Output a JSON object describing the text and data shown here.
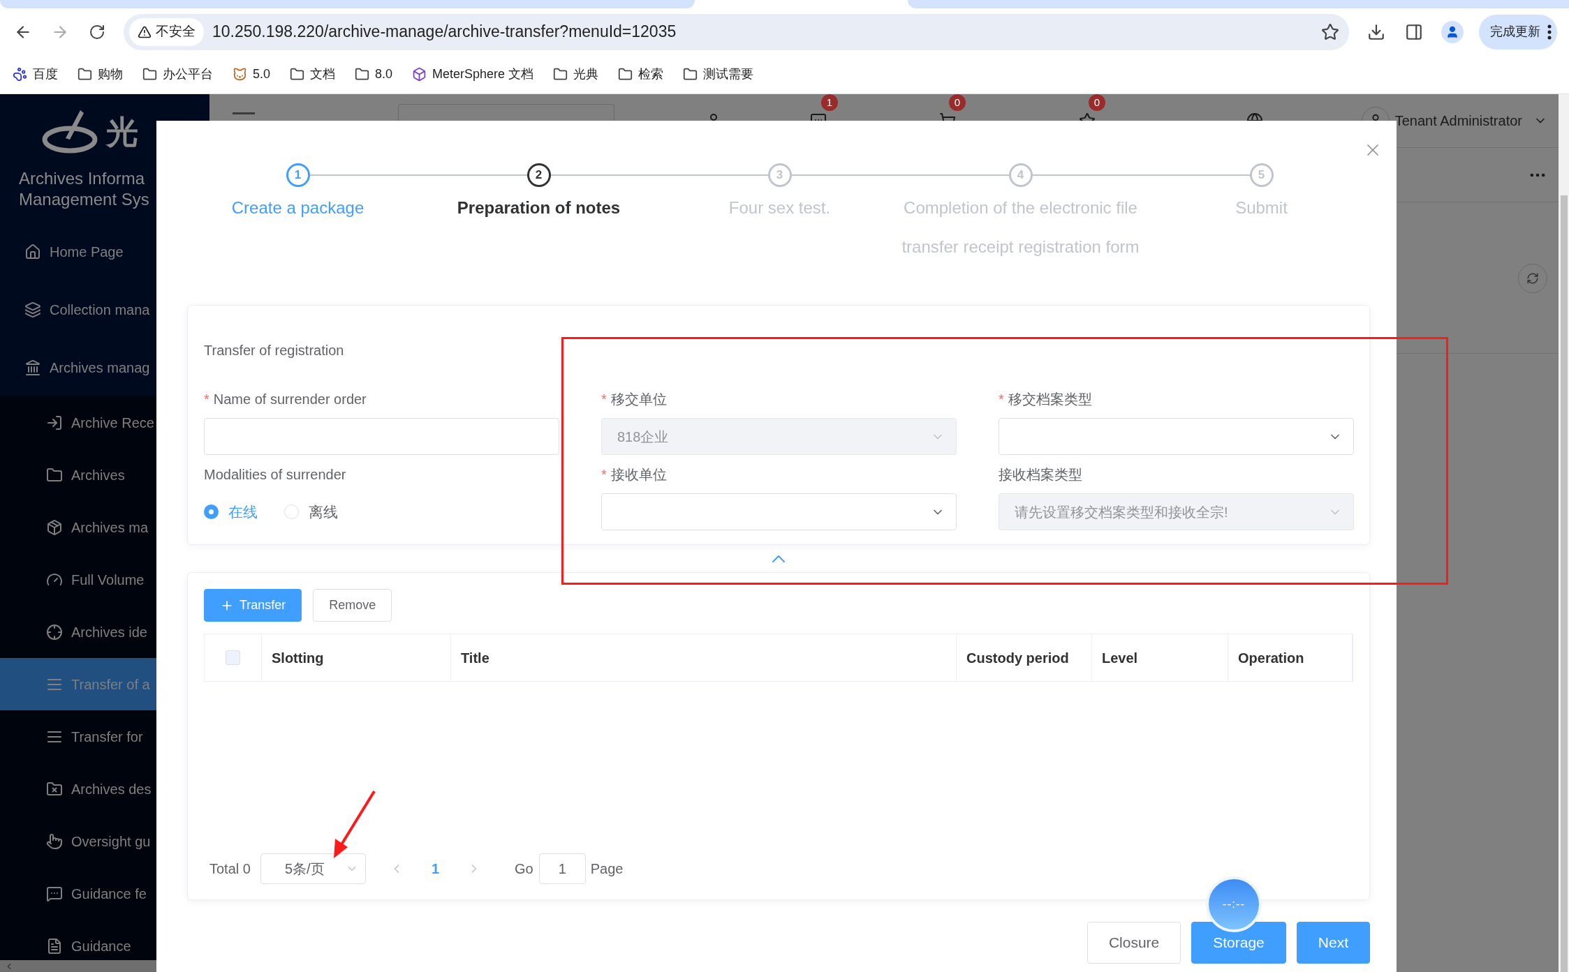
{
  "browser": {
    "insecure_label": "不安全",
    "url": "10.250.198.220/archive-manage/archive-transfer?menuId=12035",
    "update_button": "完成更新",
    "bookmarks": [
      {
        "label": "百度",
        "kind": "paw"
      },
      {
        "label": "购物",
        "kind": "folder"
      },
      {
        "label": "办公平台",
        "kind": "folder"
      },
      {
        "label": "5.0",
        "kind": "cat"
      },
      {
        "label": "文档",
        "kind": "folder"
      },
      {
        "label": "8.0",
        "kind": "folder"
      },
      {
        "label": "MeterSphere 文档",
        "kind": "cube"
      },
      {
        "label": "光典",
        "kind": "folder"
      },
      {
        "label": "检索",
        "kind": "folder"
      },
      {
        "label": "测试需要",
        "kind": "folder"
      }
    ]
  },
  "sidebar": {
    "logo_text": "光",
    "title_lines": [
      "Archives Informa",
      "Management Sys"
    ],
    "items": [
      {
        "label": "Home Page",
        "selected": false
      },
      {
        "label": "Collection mana",
        "selected": false
      },
      {
        "label": "Archives manag",
        "selected": false
      },
      {
        "label": "Archive Rece",
        "selected": false
      },
      {
        "label": "Archives",
        "selected": false
      },
      {
        "label": "Archives ma",
        "selected": false
      },
      {
        "label": "Full Volume",
        "selected": false
      },
      {
        "label": "Archives ide",
        "selected": false
      },
      {
        "label": "Transfer of a",
        "selected": true
      },
      {
        "label": "Transfer for",
        "selected": false
      },
      {
        "label": "Archives des",
        "selected": false
      },
      {
        "label": "Oversight gu",
        "selected": false
      },
      {
        "label": "Guidance fe",
        "selected": false
      },
      {
        "label": "Guidance",
        "selected": false
      }
    ]
  },
  "header": {
    "badges": [
      "1",
      "0",
      "0"
    ],
    "user": "Tenant Administrator"
  },
  "modal": {
    "steps": [
      {
        "number": "1",
        "label_lines": [
          "Create a package"
        ],
        "kind": "finish"
      },
      {
        "number": "2",
        "label_lines": [
          "Preparation of notes"
        ],
        "kind": "process"
      },
      {
        "number": "3",
        "label_lines": [
          "Four sex test."
        ],
        "kind": "wait"
      },
      {
        "number": "4",
        "label_lines": [
          "Completion of the electronic file",
          "transfer receipt registration form"
        ],
        "kind": "wait"
      },
      {
        "number": "5",
        "label_lines": [
          "Submit"
        ],
        "kind": "wait"
      }
    ],
    "form": {
      "title": "Transfer of registration",
      "fields": [
        {
          "label": "Name of surrender order",
          "mark": "*",
          "kind": "input",
          "disabled": false
        },
        {
          "label": "移交单位",
          "mark": "*",
          "kind": "select",
          "value": "818企业",
          "disabled": true
        },
        {
          "label": "移交档案类型",
          "mark": "*",
          "kind": "select",
          "disabled": false
        },
        {
          "label": "Modalities of surrender",
          "kind": "radio",
          "options": [
            {
              "label": "在线",
              "selected": true
            },
            {
              "label": "离线",
              "selected": false
            }
          ]
        },
        {
          "label": "接收单位",
          "mark": "*",
          "kind": "select",
          "disabled": false
        },
        {
          "label": "接收档案类型",
          "kind": "select",
          "placeholder": "请先设置移交档案类型和接收全宗!",
          "disabled": true
        }
      ]
    },
    "table": {
      "buttons": [
        {
          "label": "Transfer",
          "kind": "primary"
        },
        {
          "label": "Remove",
          "kind": "default"
        }
      ],
      "select_all": {
        "checked": false
      },
      "columns": [
        "Slotting",
        "Title",
        "Custody period",
        "Level",
        "Operation"
      ],
      "pagination": {
        "total": "Total 0",
        "page_size": "5条/页",
        "pages": [
          {
            "label": "1",
            "selected": true
          }
        ],
        "go": "Go",
        "jump_value": "1",
        "page_label": "Page"
      }
    },
    "footer": [
      {
        "label": "Closure",
        "kind": "default"
      },
      {
        "label": "Storage",
        "kind": "primary"
      },
      {
        "label": "Next",
        "kind": "primary"
      }
    ],
    "floating_ball": "--:--"
  }
}
